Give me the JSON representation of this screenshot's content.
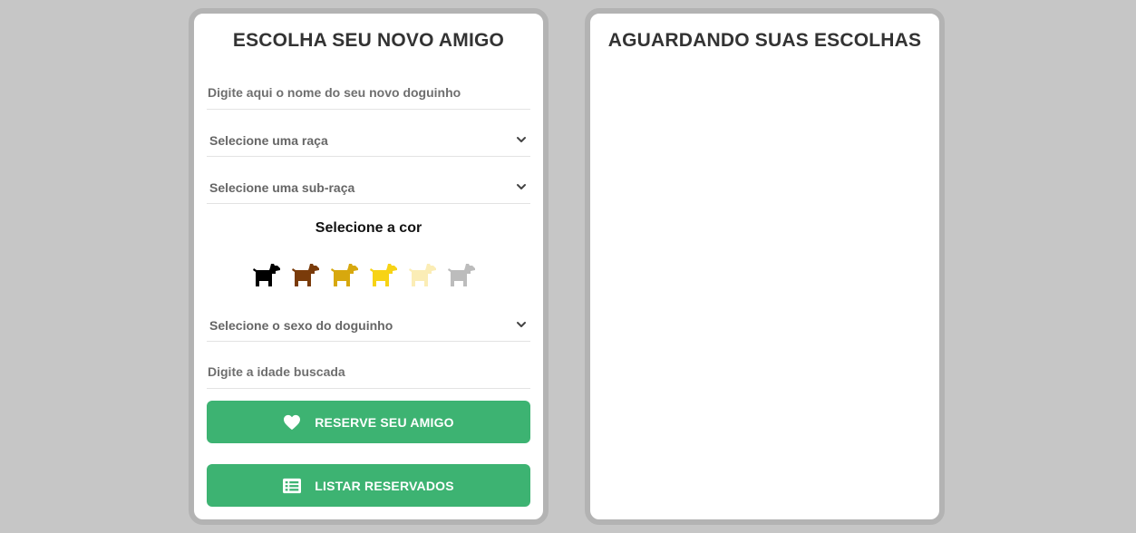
{
  "form": {
    "title": "ESCOLHA SEU NOVO AMIGO",
    "name_placeholder": "Digite aqui o nome do seu novo doguinho",
    "breed_select": "Selecione uma raça",
    "subbreed_select": "Selecione uma sub-raça",
    "color_title": "Selecione a cor",
    "colors": [
      {
        "name": "black",
        "hex": "#000000"
      },
      {
        "name": "brown",
        "hex": "#7a3b0a"
      },
      {
        "name": "golden",
        "hex": "#d7a80e"
      },
      {
        "name": "yellow",
        "hex": "#f7d315"
      },
      {
        "name": "cream",
        "hex": "#fbedb6"
      },
      {
        "name": "gray",
        "hex": "#bcbcbc"
      }
    ],
    "sex_select": "Selecione o sexo do doguinho",
    "age_placeholder": "Digite a idade buscada",
    "reserve_button": "RESERVE SEU AMIGO",
    "list_button": "LISTAR RESERVADOS"
  },
  "result": {
    "title": "AGUARDANDO SUAS ESCOLHAS"
  },
  "theme": {
    "accent": "#3db372",
    "background": "#c6c6c6",
    "panel_border": "#b3b3b3"
  },
  "icons": {
    "reserve": "heart-icon",
    "list": "list-icon",
    "select": "chevron-down-icon",
    "color_option": "dog-icon"
  }
}
